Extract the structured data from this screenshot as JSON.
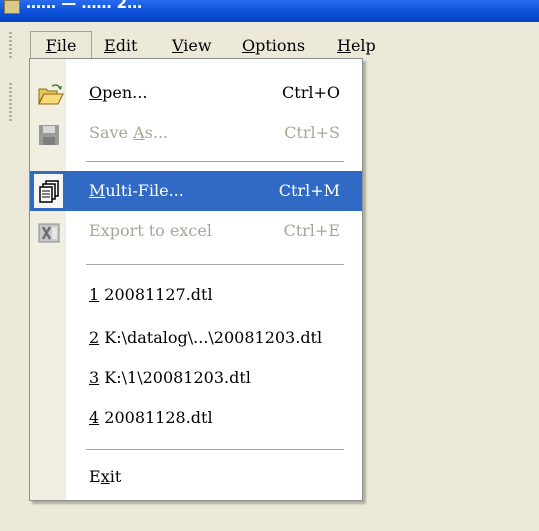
{
  "window": {
    "title": "…… — …… 2…"
  },
  "menubar": {
    "items": [
      {
        "label": "File",
        "mn": "F",
        "rest": "ile"
      },
      {
        "label": "Edit",
        "mn": "E",
        "rest": "dit"
      },
      {
        "label": "View",
        "mn": "V",
        "rest": "iew"
      },
      {
        "label": "Options",
        "mn": "O",
        "rest": "ptions"
      },
      {
        "label": "Help",
        "mn": "H",
        "rest": "elp"
      }
    ]
  },
  "file_menu": {
    "open": {
      "label_mn": "O",
      "label_rest": "pen...",
      "shortcut": "Ctrl+O",
      "icon": "open-folder-icon"
    },
    "save_as": {
      "label_pre": "Save ",
      "label_mn": "A",
      "label_rest": "s...",
      "shortcut": "Ctrl+S",
      "icon": "floppy-disk-icon",
      "disabled": true
    },
    "multi_file": {
      "label_mn": "M",
      "label_rest": "ulti-File...",
      "shortcut": "Ctrl+M",
      "icon": "multi-file-icon",
      "selected": true
    },
    "export_excel": {
      "label": "Export to excel",
      "shortcut": "Ctrl+E",
      "icon": "excel-icon",
      "disabled": true
    },
    "recent": [
      {
        "num": "1",
        "path": " 20081127.dtl"
      },
      {
        "num": "2",
        "path": " K:\\datalog\\...\\20081203.dtl"
      },
      {
        "num": "3",
        "path": " K:\\1\\20081203.dtl"
      },
      {
        "num": "4",
        "path": " 20081128.dtl"
      }
    ],
    "exit": {
      "label_pre": "E",
      "label_mn": "x",
      "label_rest": "it"
    }
  },
  "colors": {
    "highlight": "#316ac5",
    "menu_bg": "#ece9d8",
    "disabled_text": "#a9a596",
    "titlebar": "#0a4ed6"
  }
}
